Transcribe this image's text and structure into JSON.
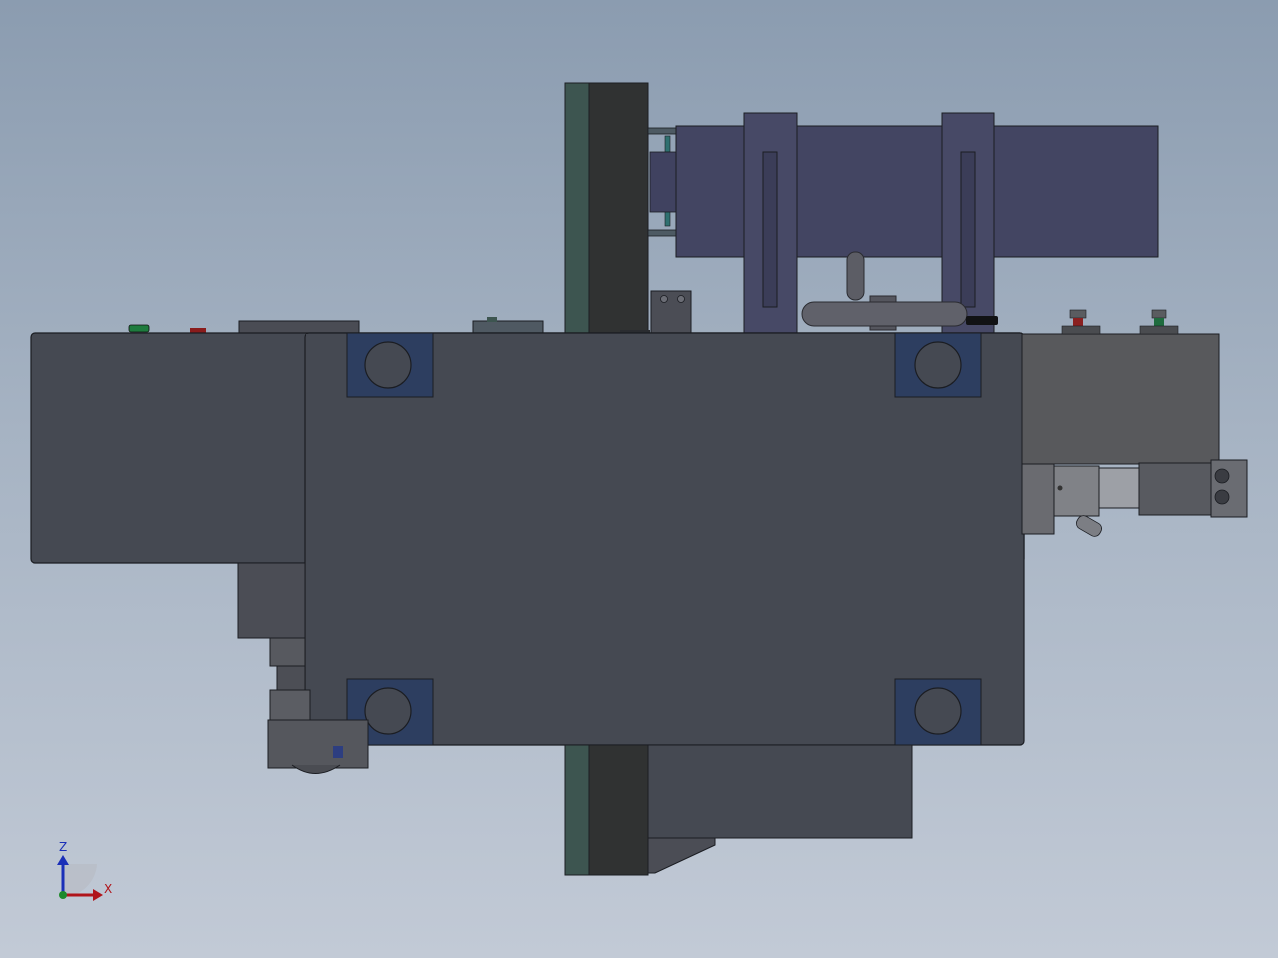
{
  "viewport": {
    "background_top": "#8b9cb0",
    "background_bottom": "#c2cad6"
  },
  "model_colors": {
    "body": "#454952",
    "body_edge": "#1b1d22",
    "plate_dark": "#303232",
    "plate_green": "#3d5550",
    "motor_purple": "#434562",
    "bearing_blue": "#2d3e60",
    "gearbox": "#58595c",
    "handle": "#5c5d65"
  },
  "triad": {
    "z_label": "Z",
    "x_label": "X",
    "z_color": "#1a2fb8",
    "x_color": "#b0141a",
    "origin_color": "#1d8a2b"
  }
}
